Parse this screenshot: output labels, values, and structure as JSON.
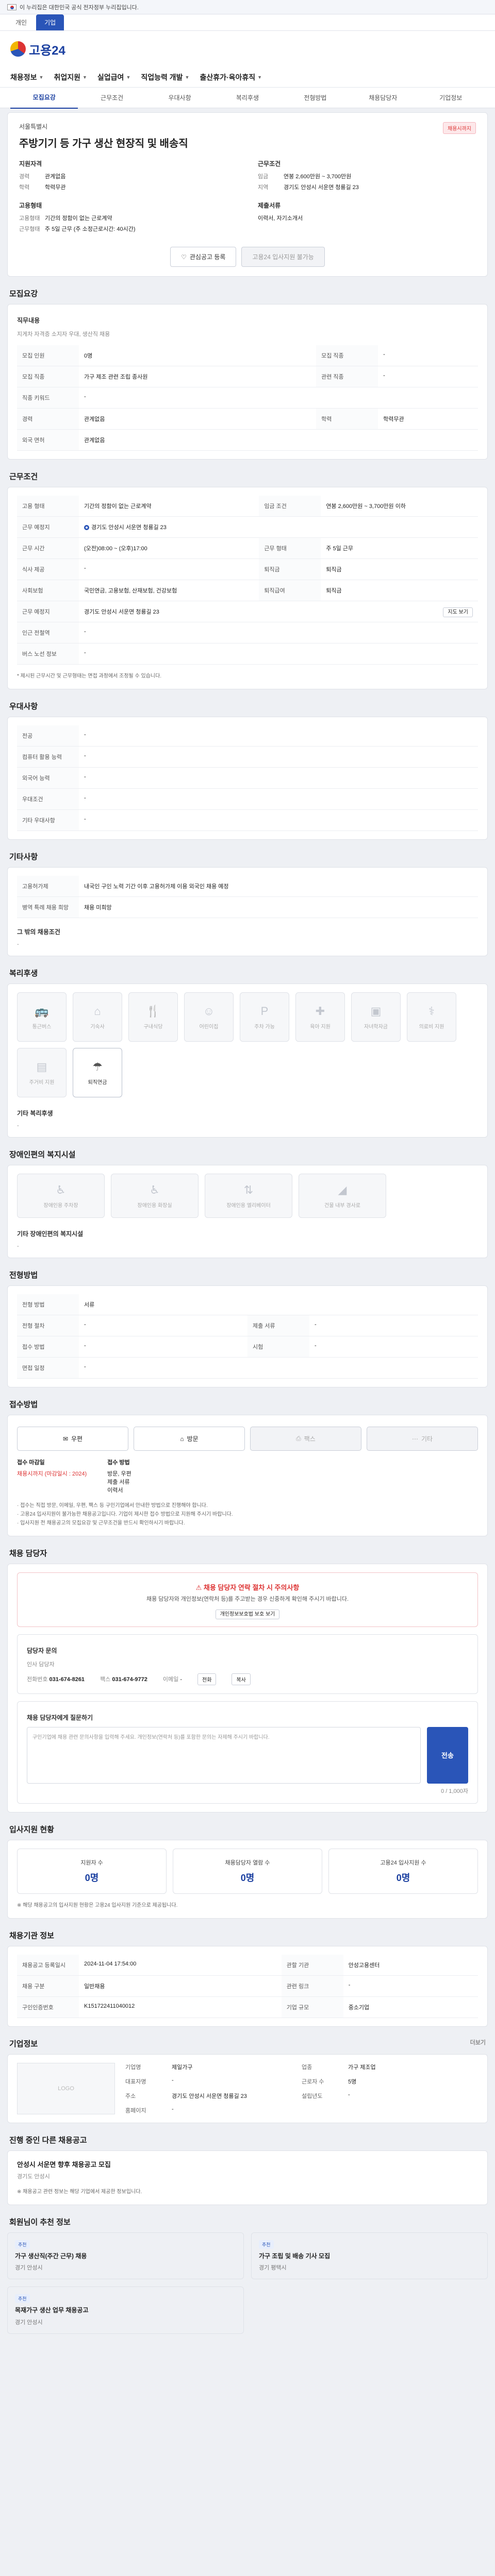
{
  "gov_banner": {
    "text": "이 누리집은 대한민국 공식 전자정부 누리집입니다.",
    "more": ""
  },
  "site_tabs": [
    "개인",
    "기업"
  ],
  "logo": {
    "text": "고용24"
  },
  "gnb": [
    "채용정보",
    "취업지원",
    "실업급여",
    "직업능력 개발",
    "출산휴가·육아휴직"
  ],
  "subtabs": [
    "모집요강",
    "근무조건",
    "우대사항",
    "복리후생",
    "전형방법",
    "채용담당자",
    "기업정보"
  ],
  "summary": {
    "company_label": "서울특별시",
    "status": "채용시까지",
    "title": "주방기기 등 가구 생산 현장직 및 배송직",
    "left_heading": "지원자격",
    "right_heading": "근무조건",
    "left_rows": [
      {
        "k": "경력",
        "v": "관계없음"
      },
      {
        "k": "학력",
        "v": "학력무관"
      }
    ],
    "right_rows": [
      {
        "k": "임금",
        "v": "연봉 2,600만원 ~ 3,700만원"
      },
      {
        "k": "지역",
        "v": "경기도 안성시 서운면 청룡길 23"
      }
    ],
    "left2_heading": "고용형태",
    "left2_rows": [
      {
        "k": "고용형태",
        "v": "기간의 정함이 없는 근로계약"
      },
      {
        "k": "근무형태",
        "v": "주 5일 근무 (주 소정근로시간: 40시간)"
      }
    ],
    "right2_heading": "제출서류",
    "right2_rows": [
      {
        "k": "",
        "v": "이력서, 자기소개서"
      }
    ],
    "btn_save": "관심공고 등록",
    "btn_apply": "고용24 입사지원 불가능"
  },
  "recruit": {
    "title": "모집요강",
    "job_desc_label": "직무내용",
    "job_desc": "지게차 자격증 소지자 우대, 생산직 채용",
    "rows": [
      {
        "k1": "모집 인원",
        "v1": "0명",
        "k2": "모집 직종",
        "v2": "-"
      },
      {
        "k1": "모집 직종",
        "v1": "가구 제조 관련 조립 종사원",
        "k2": "관련 직종",
        "v2": "-"
      },
      {
        "k1": "직종 키워드",
        "v1": "-",
        "k2": "",
        "v2": ""
      },
      {
        "k1": "경력",
        "v1": "관계없음",
        "k2": "학력",
        "v2": "학력무관"
      },
      {
        "k1": "외국 면허",
        "v1": "관계없음",
        "k2": "",
        "v2": ""
      }
    ]
  },
  "conditions": {
    "title": "근무조건",
    "rows": [
      {
        "k1": "고용 형태",
        "v1": "기간의 정함이 없는 근로계약",
        "k2": "임금 조건",
        "v2": "연봉 2,600만원 ~ 3,700만원 이하"
      },
      {
        "k1": "근무 예정지",
        "v1": "경기도 안성시 서운면 청룡길 23",
        "k2": "",
        "v2": ""
      },
      {
        "k1": "근무 시간",
        "v1": "(오전)08:00 ~ (오후)17:00",
        "k2": "근무 형태",
        "v2": "주 5일 근무"
      },
      {
        "k1": "식사 제공",
        "v1": "-",
        "k2": "퇴직금",
        "v2": "퇴직금"
      },
      {
        "k1": "사회보험",
        "v1": "국민연금, 고용보험, 산재보험, 건강보험",
        "k2": "퇴직급여",
        "v2": "퇴직금"
      },
      {
        "k1": "근무 예정지",
        "v1": "경기도 안성시 서운면 청룡길 23",
        "k2": "",
        "v2": ""
      },
      {
        "k1": "인근 전철역",
        "v1": "-",
        "k2": "",
        "v2": ""
      },
      {
        "k1": "버스 노선 정보",
        "v1": "-",
        "k2": "",
        "v2": ""
      }
    ],
    "note": "* 제시된 근무시간 및 근무형태는 면접 과정에서 조정될 수 있습니다.",
    "map_btn": "지도 보기"
  },
  "prefer": {
    "title": "우대사항",
    "rows": [
      {
        "k": "전공",
        "v": "-"
      },
      {
        "k": "컴퓨터 활용 능력",
        "v": "-"
      },
      {
        "k": "외국어 능력",
        "v": "-"
      },
      {
        "k": "우대조건",
        "v": "-"
      },
      {
        "k": "기타 우대사항",
        "v": "-"
      }
    ]
  },
  "other": {
    "title": "기타사항",
    "rows": [
      {
        "k": "고용허가제",
        "v": "내국인 구인 노력 기간 이후 고용허가제 이용 외국인 채용 예정"
      },
      {
        "k": "병역 특례 채용 희망",
        "v": "채용 미희망"
      }
    ],
    "etc_label": "그 밖의 채용조건",
    "etc_value": "-"
  },
  "welfare": {
    "title": "복리후생",
    "tiles": [
      {
        "icon": "bus-icon",
        "glyph": "🚌",
        "label": "통근버스",
        "active": false
      },
      {
        "icon": "dorm-icon",
        "glyph": "🏠",
        "label": "기숙사",
        "active": false
      },
      {
        "icon": "meal-icon",
        "glyph": "🍴",
        "label": "구내식당",
        "active": false
      },
      {
        "icon": "child-icon",
        "glyph": "👶",
        "label": "어린이집",
        "active": false
      },
      {
        "icon": "parking-icon",
        "glyph": "🅿",
        "label": "주차 가능",
        "active": false
      },
      {
        "icon": "support-icon",
        "glyph": "✚",
        "label": "육아 지원",
        "active": false
      },
      {
        "icon": "car-icon",
        "glyph": "🚗",
        "label": "자녀학자금",
        "active": false
      },
      {
        "icon": "medical-icon",
        "glyph": "⚕",
        "label": "의료비 지원",
        "active": false
      },
      {
        "icon": "housing-icon",
        "glyph": "🏢",
        "label": "주거비 지원",
        "active": false
      },
      {
        "icon": "retire-icon",
        "glyph": "☂",
        "label": "퇴직연금",
        "active": true
      }
    ],
    "etc_label": "기타 복리후생",
    "etc_value": "-"
  },
  "disability": {
    "title": "장애인편의 복지시설",
    "tiles": [
      {
        "icon": "ramp-icon",
        "glyph": "♿",
        "label": "장애인용 주차장"
      },
      {
        "icon": "toilet-icon",
        "glyph": "🚻",
        "label": "장애인용 화장실"
      },
      {
        "icon": "elevator-icon",
        "glyph": "⇅",
        "label": "장애인용 엘리베이터"
      },
      {
        "icon": "slope-icon",
        "glyph": "◢",
        "label": "건물 내부 경사로"
      }
    ],
    "etc_label": "기타 장애인편의 복지시설",
    "etc_value": "-"
  },
  "hiring": {
    "title": "전형방법",
    "rows": [
      {
        "k1": "전형 방법",
        "v1": "서류",
        "k2": "",
        "v2": ""
      },
      {
        "k1": "전형 절차",
        "v1": "-",
        "k2": "제출 서류",
        "v2": "-"
      },
      {
        "k1": "접수 방법",
        "v1": "-",
        "k2": "시험",
        "v2": "-"
      },
      {
        "k1": "면접 일정",
        "v1": "-",
        "k2": "",
        "v2": ""
      }
    ]
  },
  "apply": {
    "title": "접수방법",
    "methods": [
      {
        "label": "우편",
        "icon": "mail-icon",
        "glyph": "✉",
        "on": true
      },
      {
        "label": "방문",
        "icon": "visit-icon",
        "glyph": "⌂",
        "on": true
      },
      {
        "label": "팩스",
        "icon": "fax-icon",
        "glyph": "⎙",
        "on": false
      },
      {
        "label": "기타",
        "icon": "etc-icon",
        "glyph": "⋯",
        "on": false
      }
    ],
    "left_head": "접수 마감일",
    "left_value": "채용시까지 (마감일시 : 2024)",
    "right_head": "접수 방법",
    "right_lines": [
      "방문, 우편",
      "제출 서류",
      "이력서"
    ],
    "notes": [
      "· 접수는 직접 방문, 이메일, 우편, 팩스 등 구인기업에서 안내한 방법으로 진행해야 합니다.",
      "· 고용24 입사지원이 불가능한 채용공고입니다. 기업이 제시한 접수 방법으로 지원해 주시기 바랍니다.",
      "· 입사지원 전 채용공고의 모집요강 및 근무조건을 반드시 확인하시기 바랍니다."
    ]
  },
  "manager": {
    "title": "채용 담당자",
    "alert_title": "채용 담당자 연락 절차 시 주의사항",
    "alert_desc": "채용 담당자와 개인정보(연락처 등)를 주고받는 경우 신중하게 확인해 주시기 바랍니다.",
    "alert_btn": "개인정보보호법 보호 보기",
    "contact_head": "담당자 문의",
    "contact_name": "인사 담당자",
    "phone_label": "전화번호",
    "phone": "031-674-8261",
    "fax_label": "팩스",
    "fax": "031-674-9772",
    "email_label": "이메일",
    "email": "-",
    "call_btn": "전화",
    "copy_btn": "복사",
    "inquiry_head": "채용 담당자에게 질문하기",
    "inquiry_placeholder": "구인기업에 채용 관련 문의사항을 입력해 주세요. 개인정보(연락처 등)를 포함한 문의는 자제해 주시기 바랍니다.",
    "inquiry_count": "0 / 1,000자",
    "submit": "전송"
  },
  "stats": {
    "title": "입사지원 현황",
    "items": [
      {
        "label": "지원자 수",
        "value": "0명"
      },
      {
        "label": "채용담당자 열람 수",
        "value": "0명"
      },
      {
        "label": "고용24 입사지원 수",
        "value": "0명"
      }
    ],
    "note": "※ 해당 채용공고의 입사지원 현황은 고용24 입사지원 기준으로 제공됩니다."
  },
  "notice_info": {
    "title": "채용기관 정보",
    "rows": [
      {
        "k1": "채용공고 등록일시",
        "v1": "2024-11-04 17:54:00",
        "k2": "관할 기관",
        "v2": "안성고용센터"
      },
      {
        "k1": "채용 구분",
        "v1": "일반채용",
        "k2": "관련 링크",
        "v2": "-"
      },
      {
        "k1": "구인인증번호",
        "v1": "K151722411040012",
        "k2": "기업 규모",
        "v2": "중소기업"
      }
    ]
  },
  "company": {
    "title": "기업정보",
    "more": "더보기",
    "logo_placeholder": "LOGO",
    "rows": [
      {
        "k1": "기업명",
        "v1": "제일가구",
        "k2": "업종",
        "v2": "가구 제조업"
      },
      {
        "k1": "대표자명",
        "v1": "-",
        "k2": "근로자 수",
        "v2": "5명"
      },
      {
        "k1": "주소",
        "v1": "경기도 안성시 서운면 청룡길 23",
        "k2": "설립년도",
        "v2": "-"
      },
      {
        "k1": "홈페이지",
        "v1": "-",
        "k2": "",
        "v2": ""
      }
    ]
  },
  "similar": {
    "title": "진행 중인 다른 채용공고",
    "card_title": "안성시 서운면 향후 채용공고 모집",
    "card_meta": "경기도 안성시",
    "note": "※ 채용공고 관련 정보는 해당 기업에서 제공한 정보입니다."
  },
  "recommend": {
    "title": "회원님이 추천 정보",
    "cards": [
      {
        "badge": "추천",
        "title": "가구 생산직(주간 근무) 채용",
        "meta": "경기 안성시"
      },
      {
        "badge": "추천",
        "title": "가구 조립 및 배송 기사 모집",
        "meta": "경기 평택시"
      },
      {
        "badge": "추천",
        "title": "목재가구 생산 업무 채용공고",
        "meta": "경기 안성시"
      }
    ]
  }
}
